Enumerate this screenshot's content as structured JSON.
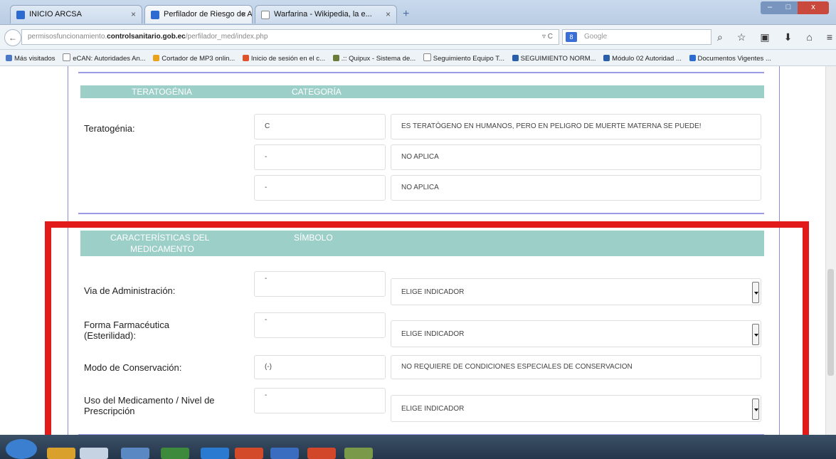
{
  "browser": {
    "tabs": [
      {
        "title": "INICIO ARCSA",
        "active": false
      },
      {
        "title": "Perfilador de Riesgo de Ali...",
        "active": true
      },
      {
        "title": "Warfarina - Wikipedia, la e...",
        "active": false
      }
    ],
    "new_tab": "+",
    "url_prefix": "permisosfuncionamiento.",
    "url_domain": "controlsanitario.gob.ec",
    "url_path": "/perfilador_med/index.php",
    "url_controls": "▿ C",
    "search_placeholder": "Google",
    "search_engine_badge": "8",
    "bookmarks": [
      "Más visitados",
      "eCAN: Autoridades An...",
      "Cortador de MP3 onlin...",
      "Inicio de sesión en el c...",
      ".:: Quipux - Sistema de...",
      "Seguimiento Equipo T...",
      "SEGUIMIENTO NORM...",
      "Módulo 02 Autoridad ...",
      "Documentos Vigentes ..."
    ]
  },
  "teratogenia_section": {
    "header_col1": "TERATOGÉNIA",
    "header_col2": "CATEGORÍA",
    "label": "Teratogénia:",
    "rows": [
      {
        "code": "C",
        "text": "ES TERATÓGENO EN HUMANOS, PERO EN PELIGRO DE MUERTE MATERNA SE PUEDE!"
      },
      {
        "code": "-",
        "text": "NO APLICA"
      },
      {
        "code": "-",
        "text": "NO APLICA"
      }
    ]
  },
  "caracteristicas_section": {
    "header_col1_line1": "CARACTERÍSTICAS DEL",
    "header_col1_line2": "MEDICAMENTO",
    "header_col2": "SÍMBOLO",
    "fields": [
      {
        "label": "Via de Administración:",
        "symbol": "-",
        "value": "ELIGE INDICADOR"
      },
      {
        "label_line1": "Forma Farmacéutica",
        "label_line2": "(Esterilidad):",
        "symbol": "-",
        "value": "ELIGE INDICADOR"
      },
      {
        "label": "Modo de Conservación:",
        "symbol": "(-)",
        "value": "NO REQUIERE DE CONDICIONES ESPECIALES DE CONSERVACION"
      },
      {
        "label_line1": "Uso del Medicamento / Nivel de",
        "label_line2": "Prescripción",
        "symbol": "-",
        "value": "ELIGE INDICADOR"
      }
    ]
  },
  "colors": {
    "header_teal": "#9dcfc9",
    "highlight_red": "#e21a1a",
    "divider_blue": "#9a9ae6"
  }
}
